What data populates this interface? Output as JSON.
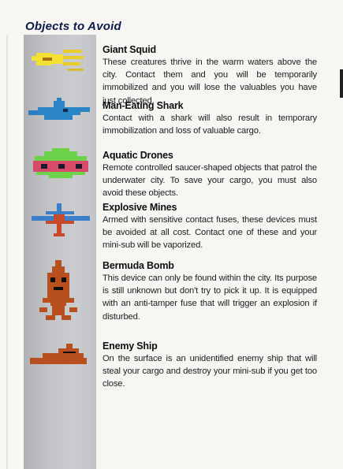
{
  "section_title": "Objects to Avoid",
  "entries": [
    {
      "title": "Giant Squid",
      "body": "These creatures thrive in the warm waters above the city. Contact them and you will be temporarily immobilized and you will lose the valuables you have just collected.",
      "icon": "giant-squid-icon"
    },
    {
      "title": "Man-Eating Shark",
      "body": "Contact with a shark will also result in temporary immobilization and loss of valuable cargo.",
      "icon": "shark-icon"
    },
    {
      "title": "Aquatic Drones",
      "body": "Remote controlled saucer-shaped objects that patrol the underwater city. To save your cargo, you must also avoid these objects.",
      "icon": "aquatic-drone-icon"
    },
    {
      "title": "Explosive Mines",
      "body": "Armed with sensitive contact fuses, these devices must be avoided at all cost. Contact one of these and your mini-sub will be vaporized.",
      "icon": "mine-icon"
    },
    {
      "title": "Bermuda Bomb",
      "body": "This device can only be found within the city. Its purpose is still unknown but don't try to pick it up. It is equipped with an anti-tamper fuse that will trigger an explosion if disturbed.",
      "icon": "bermuda-bomb-icon"
    },
    {
      "title": "Enemy Ship",
      "body": "On the surface is an unidentified enemy ship that will steal your cargo and destroy your mini-sub if you get too close.",
      "icon": "enemy-ship-icon"
    }
  ]
}
